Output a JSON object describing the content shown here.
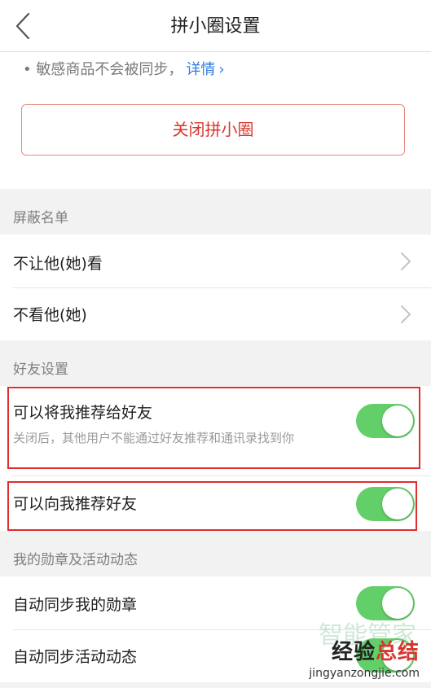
{
  "navbar": {
    "title": "拼小圈设置",
    "back_icon": "chevron-left-icon"
  },
  "top": {
    "bullet": "•",
    "sensitive_note": "敏感商品不会被同步，",
    "detail_link": "详情",
    "detail_chevron": "›",
    "close_button": "关闭拼小圈"
  },
  "block_list": {
    "header": "屏蔽名单",
    "items": [
      {
        "label": "不让他(她)看"
      },
      {
        "label": "不看他(她)"
      }
    ]
  },
  "friend_settings": {
    "header": "好友设置",
    "items": [
      {
        "label": "可以将我推荐给好友",
        "sub": "关闭后，其他用户不能通过好友推荐和通讯录找到你",
        "on": true
      },
      {
        "label": "可以向我推荐好友",
        "on": true
      }
    ]
  },
  "medals": {
    "header": "我的勋章及活动动态",
    "items": [
      {
        "label": "自动同步我的勋章",
        "on": true
      },
      {
        "label": "自动同步活动动态",
        "on": true
      }
    ]
  },
  "watermark": {
    "faded": "智能管家",
    "main_a": "经验",
    "main_b": "总结",
    "url": "jingyanzongjie.com"
  },
  "colors": {
    "toggle_on": "#62cf68",
    "accent_red": "#d9352d",
    "link_blue": "#2f7ce0",
    "highlight": "#e02d2d"
  }
}
